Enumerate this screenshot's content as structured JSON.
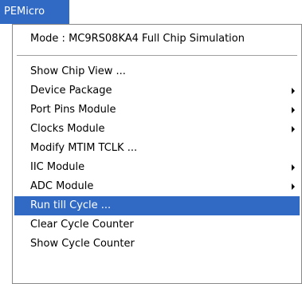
{
  "menubar": {
    "title": "PEMicro"
  },
  "menu": {
    "mode_item": "Mode : MC9RS08KA4 Full Chip Simulation",
    "items": [
      {
        "label": "Show Chip View ...",
        "submenu": false
      },
      {
        "label": "Device Package",
        "submenu": true
      },
      {
        "label": "Port Pins Module",
        "submenu": true
      },
      {
        "label": "Clocks Module",
        "submenu": true
      },
      {
        "label": "Modify MTIM TCLK ...",
        "submenu": false
      },
      {
        "label": "IIC Module",
        "submenu": true
      },
      {
        "label": "ADC Module",
        "submenu": true
      },
      {
        "label": "Run till Cycle ...",
        "submenu": false,
        "highlighted": true
      },
      {
        "label": "Clear Cycle Counter",
        "submenu": false
      },
      {
        "label": "Show Cycle Counter",
        "submenu": false
      }
    ]
  },
  "colors": {
    "highlight": "#316ac5",
    "highlight_text": "#ffffff",
    "menu_background": "#ffffff",
    "border": "#8a8a8a"
  },
  "icons": {
    "submenu_arrow": "submenu-arrow-icon"
  }
}
